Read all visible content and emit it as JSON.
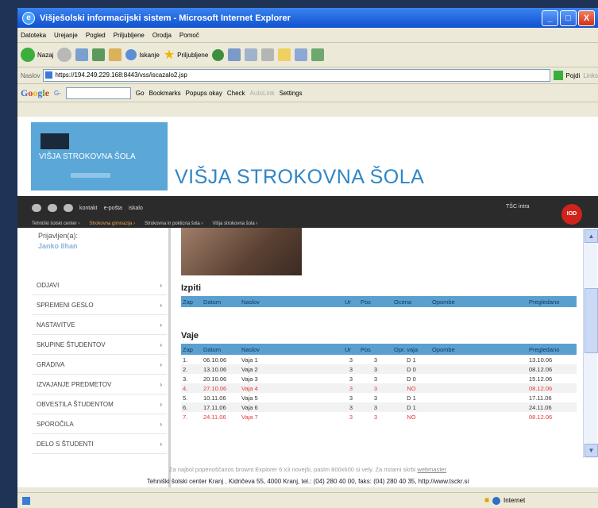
{
  "window": {
    "title": "Višješolski informacijski sistem - Microsoft Internet Explorer",
    "min": "_",
    "max": "□",
    "close": "X"
  },
  "menubar": [
    "Datoteka",
    "Urejanje",
    "Pogled",
    "Priljubljene",
    "Orodja",
    "Pomoč"
  ],
  "toolbar": {
    "back": "Nazaj",
    "search": "Iskanje",
    "favorites": "Priljubljene"
  },
  "address": {
    "label": "Naslov",
    "value": "https://194.249.229.168:8443/vss/iscazalo2.jsp",
    "go": "Pojdi",
    "links": "Links"
  },
  "google": {
    "logo": "Google",
    "g": "G-",
    "go": "Go",
    "bookmarks": "Bookmarks",
    "popups": "Popups okay",
    "check": "Check",
    "autolink": "AutoLink",
    "settings": "Settings"
  },
  "header": {
    "logo_text": "VIŠJA STROKOVNA ŠOLA",
    "title": "VIŠJA STROKOVNA ŠOLA"
  },
  "nav": {
    "top_links": [
      "kontakt",
      "e-pošta",
      "iskalo"
    ],
    "tsc": "TŠC intra",
    "logout": "IOD",
    "crumbs": [
      "Tehniški šolski center ›",
      "Strokovna gimnazija ›",
      "Strokovna in poklicna šola ›",
      "Višja strokovna šola ›"
    ]
  },
  "login": {
    "label": "Prijavljen(a):",
    "user": "Janko Ilhan"
  },
  "menu": [
    "ODJAVI",
    "SPREMENI GESLO",
    "NASTAVITVE",
    "SKUPINE ŠTUDENTOV",
    "GRADIVA",
    "IZVAJANJE PREDMETOV",
    "OBVESTILA ŠTUDENTOM",
    "SPOROČILA",
    "DELO S ŠTUDENTI"
  ],
  "menu_arrow": "›",
  "izpiti": {
    "title": "Izpiti",
    "cols": [
      "Zap",
      "Datum",
      "Naslov",
      "Ur",
      "Pos",
      "Ocena",
      "Opombe",
      "Pregledano"
    ]
  },
  "vaje": {
    "title": "Vaje",
    "cols": [
      "Zap",
      "Datum",
      "Naslov",
      "Ur",
      "Pos",
      "Opr. vaja",
      "Opombe",
      "Pregledano"
    ],
    "rows": [
      {
        "zap": "1.",
        "datum": "06.10.06",
        "naslov": "Vaja 1",
        "ur": "3",
        "pos": "3",
        "opr": "D 1",
        "opombe": "",
        "pregledano": "13.10.06",
        "red": false
      },
      {
        "zap": "2.",
        "datum": "13.10.06",
        "naslov": "Vaja 2",
        "ur": "3",
        "pos": "3",
        "opr": "D 0",
        "opombe": "",
        "pregledano": "08.12.06",
        "red": false
      },
      {
        "zap": "3.",
        "datum": "20.10.06",
        "naslov": "Vaja 3",
        "ur": "3",
        "pos": "3",
        "opr": "D 0",
        "opombe": "",
        "pregledano": "15.12.06",
        "red": false
      },
      {
        "zap": "4.",
        "datum": "27.10.06",
        "naslov": "Vaja 4",
        "ur": "3",
        "pos": "3",
        "opr": "NO",
        "opombe": "",
        "pregledano": "08.12.06",
        "red": true
      },
      {
        "zap": "5.",
        "datum": "10.11.06",
        "naslov": "Vaja 5",
        "ur": "3",
        "pos": "3",
        "opr": "D 1",
        "opombe": "",
        "pregledano": "17.11.06",
        "red": false
      },
      {
        "zap": "6.",
        "datum": "17.11.06",
        "naslov": "Vaja 6",
        "ur": "3",
        "pos": "3",
        "opr": "D 1",
        "opombe": "",
        "pregledano": "24.11.06",
        "red": false
      },
      {
        "zap": "7.",
        "datum": "24.11.06",
        "naslov": "Vaja 7",
        "ur": "3",
        "pos": "3",
        "opr": "NO",
        "opombe": "",
        "pregledano": "08.12.06",
        "red": true
      }
    ]
  },
  "notice": {
    "text": "Za najbol popenoščanos brownt Explorer 6.x3 novejši, paslm 800x600 si vely. Za ristami skrbi ",
    "link": "webmaster"
  },
  "footer": "Tehniški šolski center Kranj , Kidričeva 55, 4000 Kranj, tel.: (04) 280 40 00, faks: (04) 280 40 35, http://www.tsckr.si",
  "status": {
    "zone": "Internet"
  },
  "colors": {
    "accent": "#2f86c6",
    "table_header": "#5aa0cf",
    "warn": "#e23a3a"
  }
}
